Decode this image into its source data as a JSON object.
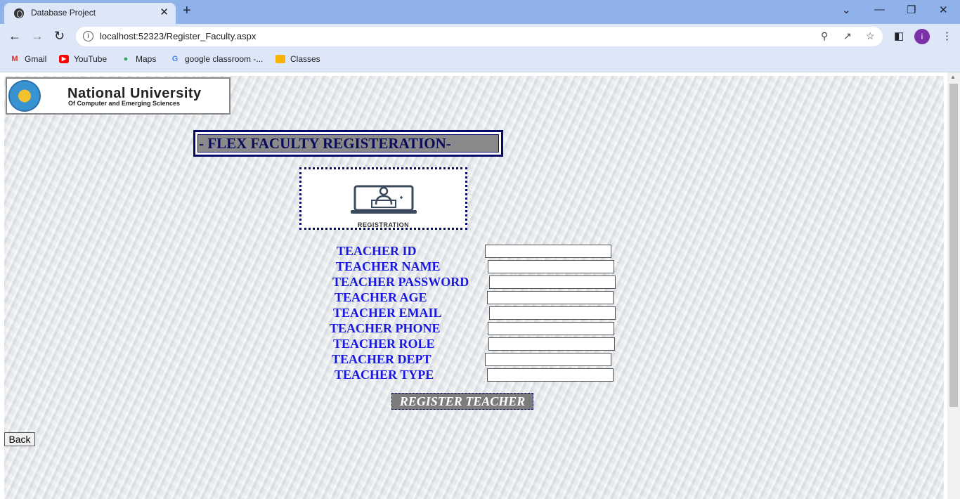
{
  "browser": {
    "tab_title": "Database Project",
    "tab_close": "✕",
    "new_tab": "+",
    "url": "localhost:52323/Register_Faculty.aspx",
    "profile_initial": "i",
    "window_controls": [
      "⌄",
      "—",
      "❐",
      "✕"
    ],
    "bookmarks": [
      "Gmail",
      "YouTube",
      "Maps",
      "google classroom -...",
      "Classes"
    ]
  },
  "page": {
    "logo": {
      "name": "National University",
      "subtitle": "Of Computer and Emerging Sciences"
    },
    "heading": "- FLEX FACULTY REGISTERATION-",
    "registration_caption": "REGISTRATION",
    "form": {
      "labels": [
        "TEACHER ID",
        "TEACHER NAME",
        "TEACHER PASSWORD",
        "TEACHER AGE",
        "TEACHER EMAIL",
        "TEACHER PHONE",
        "TEACHER ROLE",
        "TEACHER DEPT",
        "TEACHER TYPE"
      ],
      "values": [
        "",
        "",
        "",
        "",
        "",
        "",
        "",
        "",
        ""
      ]
    },
    "register_button": "REGISTER TEACHER",
    "back_button": "Back"
  }
}
